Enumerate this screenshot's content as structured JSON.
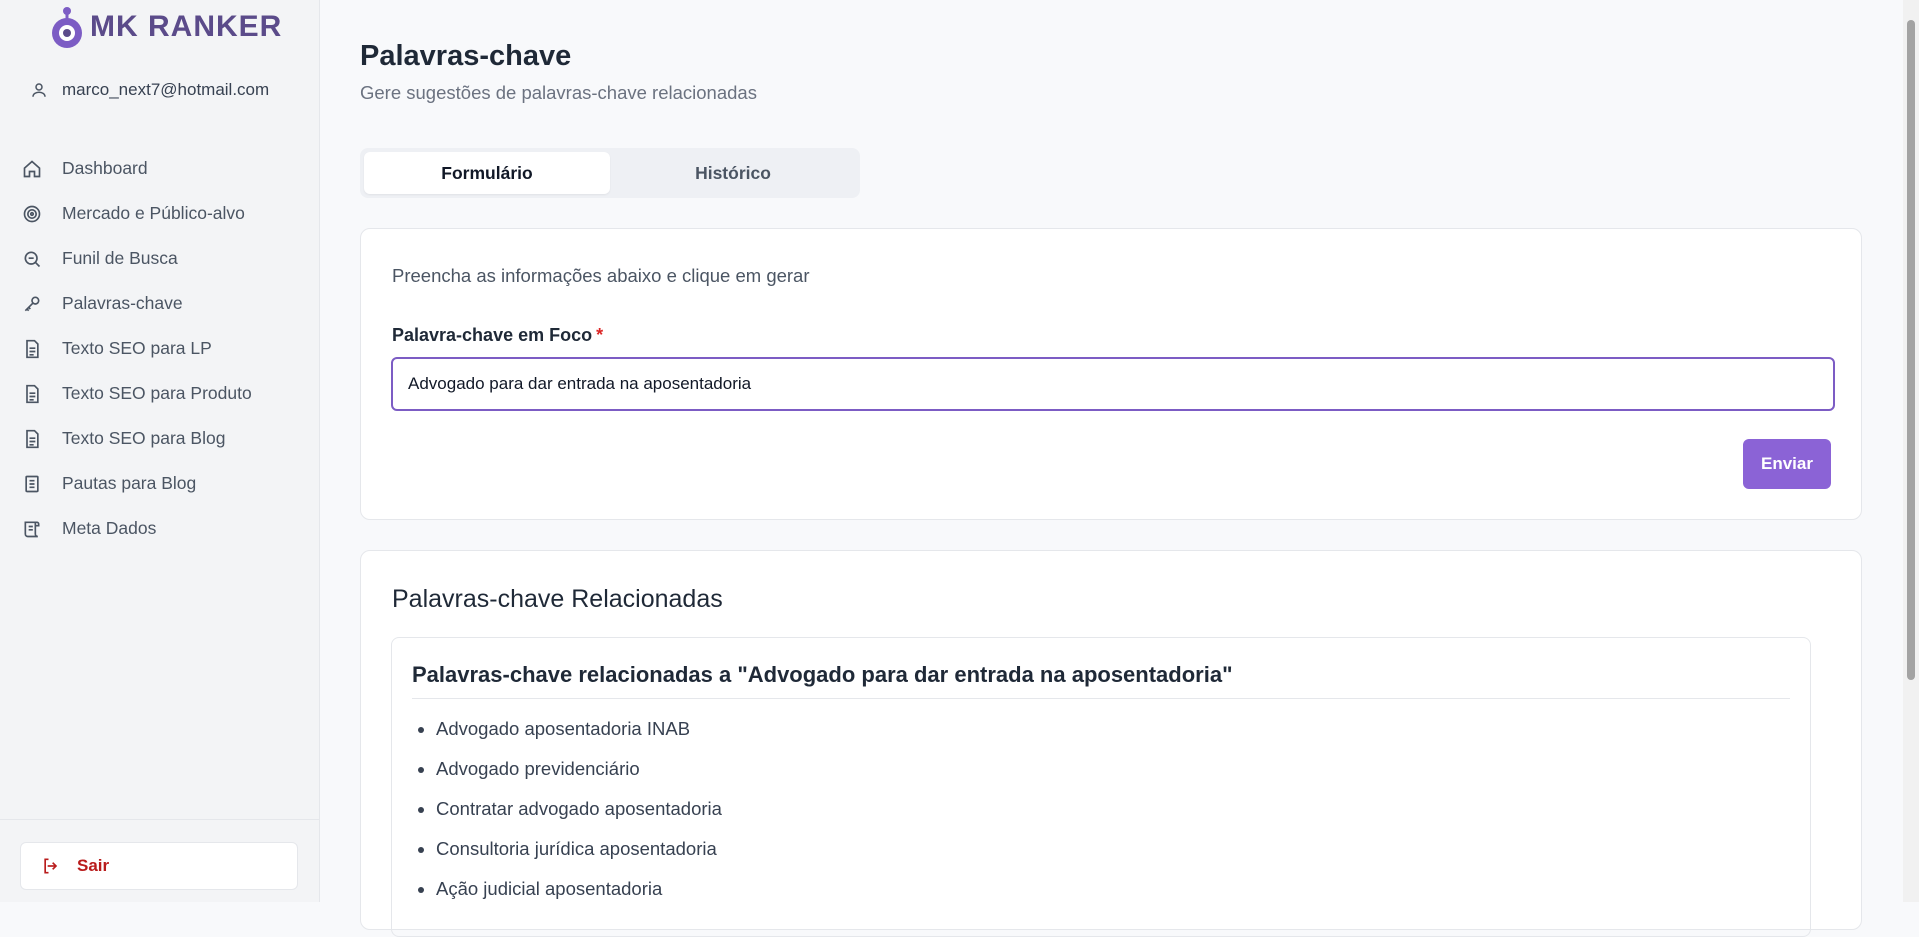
{
  "brand": {
    "name": "MK RANKER",
    "accent": "#7c5cc4"
  },
  "user": {
    "email": "marco_next7@hotmail.com"
  },
  "sidebar": {
    "items": [
      {
        "label": "Dashboard",
        "icon": "home-icon"
      },
      {
        "label": "Mercado e Público-alvo",
        "icon": "target-icon"
      },
      {
        "label": "Funil de Busca",
        "icon": "search-zoom-icon"
      },
      {
        "label": "Palavras-chave",
        "icon": "key-icon"
      },
      {
        "label": "Texto SEO para LP",
        "icon": "document-icon"
      },
      {
        "label": "Texto SEO para Produto",
        "icon": "document-icon"
      },
      {
        "label": "Texto SEO para Blog",
        "icon": "document-icon"
      },
      {
        "label": "Pautas para Blog",
        "icon": "notebook-icon"
      },
      {
        "label": "Meta Dados",
        "icon": "scroll-icon"
      }
    ],
    "logout_label": "Sair"
  },
  "page": {
    "title": "Palavras-chave",
    "subtitle": "Gere sugestões de palavras-chave relacionadas",
    "tabs": [
      "Formulário",
      "Histórico"
    ],
    "active_tab": "Formulário"
  },
  "form": {
    "description": "Preencha as informações abaixo e clique em gerar",
    "field_label": "Palavra-chave em Foco",
    "required_mark": "*",
    "field_value": "Advogado para dar entrada na aposentadoria",
    "submit_label": "Enviar"
  },
  "results": {
    "title": "Palavras-chave Relacionadas",
    "heading": "Palavras-chave relacionadas a \"Advogado para dar entrada na aposentadoria\"",
    "keywords": [
      "Advogado aposentadoria INAB",
      "Advogado previdenciário",
      "Contratar advogado aposentadoria",
      "Consultoria jurídica aposentadoria",
      "Ação judicial aposentadoria"
    ]
  }
}
